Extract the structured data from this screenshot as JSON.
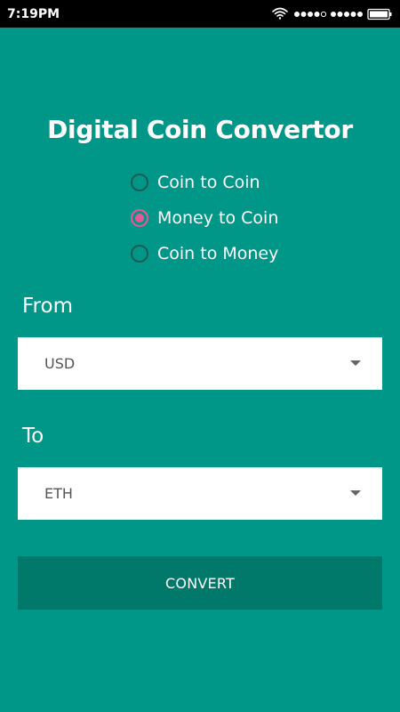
{
  "status_bar": {
    "time": "7:19PM",
    "icons": [
      "wifi-icon",
      "signal-icon",
      "signal-icon",
      "battery-icon"
    ]
  },
  "app": {
    "title": "Digital Coin Convertor"
  },
  "conversion_modes": [
    {
      "label": "Coin to Coin",
      "selected": false
    },
    {
      "label": "Money to Coin",
      "selected": true
    },
    {
      "label": "Coin to Money",
      "selected": false
    }
  ],
  "from": {
    "label": "From",
    "value": "USD"
  },
  "to": {
    "label": "To",
    "value": "ETH"
  },
  "convert_button": {
    "label": "CONVERT"
  },
  "colors": {
    "background": "#009688",
    "button": "#00796b",
    "radio_accent": "#e95893",
    "radio_unchecked": "#1f5b55",
    "status_bar": "#000000"
  }
}
